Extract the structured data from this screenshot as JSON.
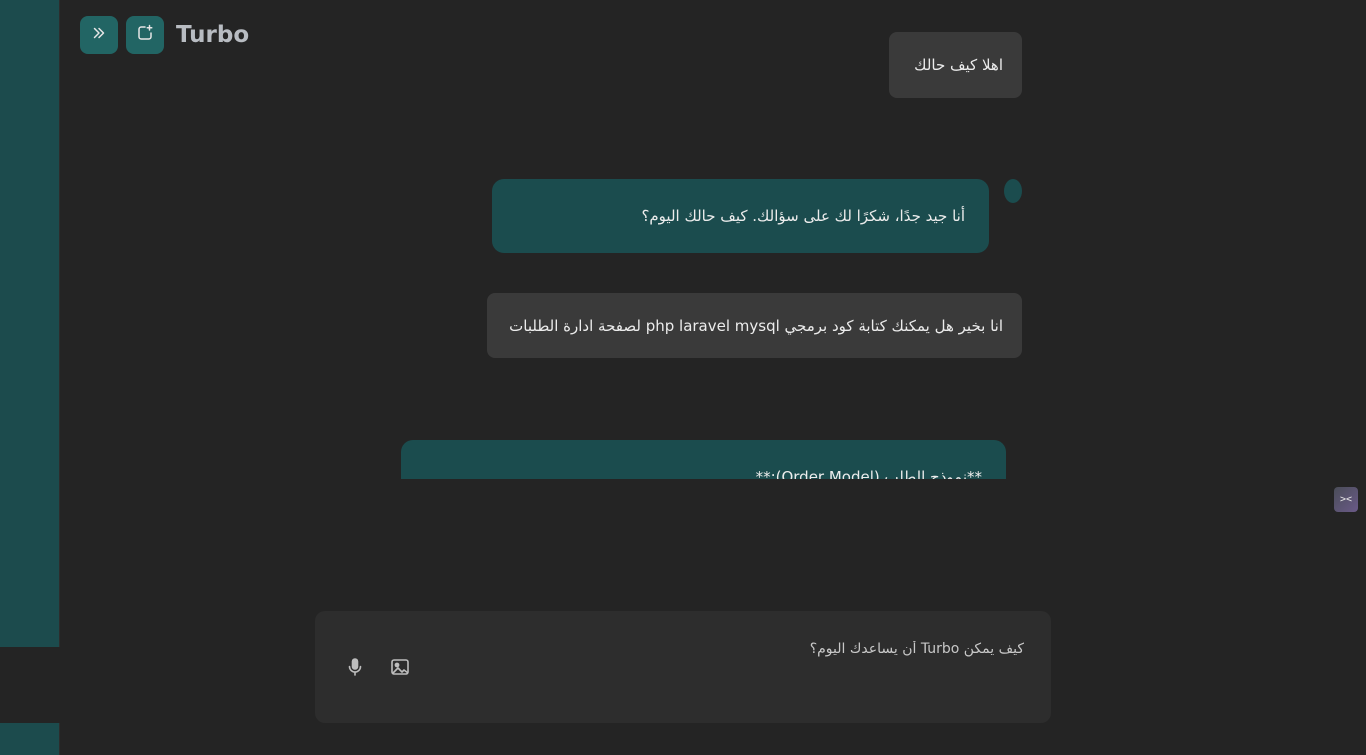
{
  "app": {
    "brand": "Turbo"
  },
  "header": {
    "expand_icon": "chevrons-right-icon",
    "new_chat_icon": "new-chat-icon"
  },
  "messages": [
    {
      "role": "user",
      "text": "اهلا كيف حالك"
    },
    {
      "role": "assistant",
      "text": "أنا جيد جدًا، شكرًا لك على سؤالك. كيف حالك اليوم؟"
    },
    {
      "role": "user",
      "text": "انا بخير هل يمكنك كتابة كود برمجي php laravel mysql لصفحة ادارة الطلبات"
    },
    {
      "role": "assistant",
      "text": "**نموذج الطلب (Order Model):**"
    }
  ],
  "composer": {
    "placeholder": "كيف يمكن Turbo أن يساعدك اليوم؟",
    "mic_icon": "microphone-icon",
    "image_icon": "image-icon"
  },
  "side_toggle": {
    "label": "><"
  },
  "colors": {
    "background": "#242424",
    "sidebar": "#1c4b4d",
    "accent": "#226564",
    "assistant_bubble": "#1b4c4e",
    "user_bubble": "#3a3a3a"
  }
}
